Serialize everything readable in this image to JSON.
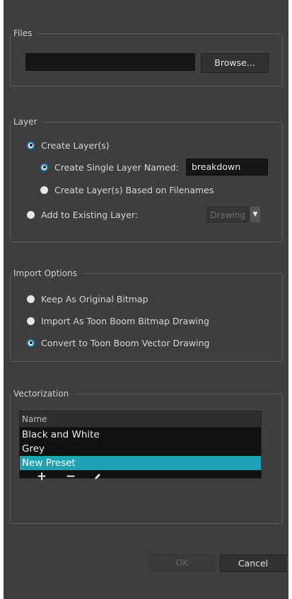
{
  "files": {
    "legend": "Files",
    "path_value": "",
    "browse_label": "Browse..."
  },
  "layer": {
    "legend": "Layer",
    "create_layers_label": "Create Layer(s)",
    "create_single_label": "Create Single Layer Named:",
    "single_layer_name": "breakdown",
    "based_on_filenames_label": "Create Layer(s) Based on Filenames",
    "add_existing_label": "Add to Existing Layer:",
    "existing_layer_value": "Drawing"
  },
  "import_options": {
    "legend": "Import Options",
    "keep_original_label": "Keep As Original Bitmap",
    "import_bitmap_label": "Import As Toon Boom Bitmap Drawing",
    "convert_vector_label": "Convert to Toon Boom Vector Drawing"
  },
  "vectorization": {
    "legend": "Vectorization",
    "column_header": "Name",
    "presets": [
      "Black and White",
      "Grey",
      "New Preset"
    ],
    "selected_index": 2,
    "add_glyph": "+",
    "remove_glyph": "−",
    "edit_icon": "pencil-icon"
  },
  "footer": {
    "ok_label": "OK",
    "cancel_label": "Cancel"
  },
  "colors": {
    "dialog_bg": "#3e3e3e",
    "selection": "#1fa2b5",
    "radio_accent": "#1d8bc1"
  }
}
